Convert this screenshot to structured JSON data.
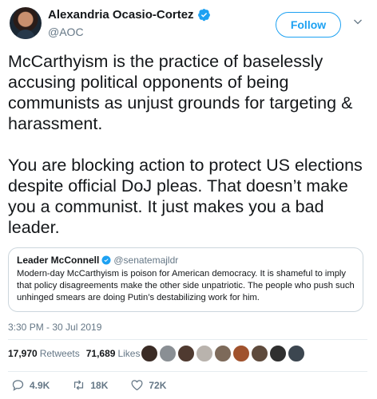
{
  "author": {
    "name": "Alexandria Ocasio-Cortez",
    "handle": "@AOC",
    "follow_label": "Follow"
  },
  "tweet": {
    "text": "McCarthyism is the practice of baselessly accusing political opponents of being communists as unjust grounds for targeting & harassment.\n\nYou are blocking action to protect US elections despite official DoJ pleas. That doesn’t make you a communist. It just makes you a bad leader.",
    "timestamp": "3:30 PM - 30 Jul 2019"
  },
  "quote": {
    "name": "Leader McConnell",
    "handle": "@senatemajldr",
    "text": "Modern-day McCarthyism is poison for American democracy. It is shameful to imply that policy disagreements make the other side unpatriotic. The people who push such unhinged smears are doing Putin’s destabilizing work for him."
  },
  "stats": {
    "retweets_count": "17,970",
    "retweets_label": "Retweets",
    "likes_count": "71,689",
    "likes_label": "Likes"
  },
  "actions": {
    "replies": "4.9K",
    "retweets": "18K",
    "likes": "72K"
  },
  "colors": {
    "accent": "#1da1f2",
    "secondary_text": "#657786",
    "border": "#ccd6dd"
  },
  "icons": [
    "verified-badge-icon",
    "chevron-down-icon",
    "reply-icon",
    "retweet-icon",
    "heart-icon"
  ]
}
